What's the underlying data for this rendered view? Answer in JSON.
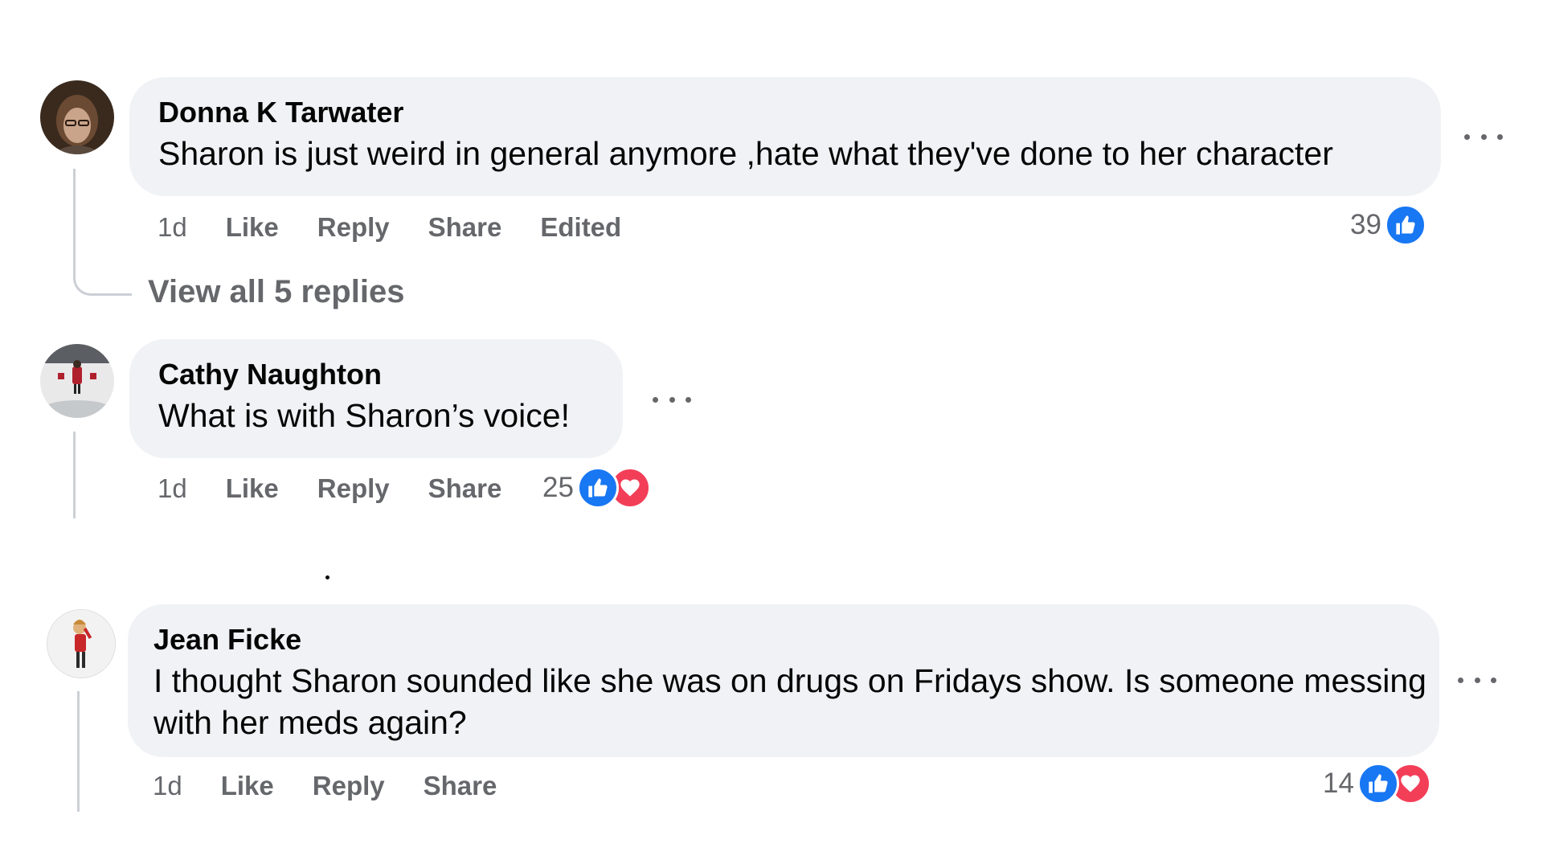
{
  "comments": [
    {
      "author": "Donna K Tarwater",
      "text": "Sharon is just weird in general anymore ,hate what they've done to her character",
      "time": "1d",
      "like_label": "Like",
      "reply_label": "Reply",
      "share_label": "Share",
      "edited_label": "Edited",
      "reaction_count": "39",
      "reactions": [
        "like-icon"
      ],
      "view_replies": "View all 5 replies"
    },
    {
      "author": "Cathy Naughton",
      "text": "What is with Sharon’s voice!",
      "time": "1d",
      "like_label": "Like",
      "reply_label": "Reply",
      "share_label": "Share",
      "reaction_count": "25",
      "reactions": [
        "like-icon",
        "love-icon"
      ]
    },
    {
      "author": "Jean Ficke",
      "text_line1": "I thought Sharon sounded like she was on drugs on Fridays show. Is someone messing",
      "text_line2": "with her meds again?",
      "time": "1d",
      "like_label": "Like",
      "reply_label": "Reply",
      "share_label": "Share",
      "reaction_count": "14",
      "reactions": [
        "like-icon",
        "love-icon"
      ]
    }
  ],
  "colors": {
    "bubble": "#f0f2f5",
    "secondary_text": "#65676b",
    "like_blue": "#1877f2",
    "love_red": "#f33e58",
    "thread_line": "#ccd0d5"
  }
}
